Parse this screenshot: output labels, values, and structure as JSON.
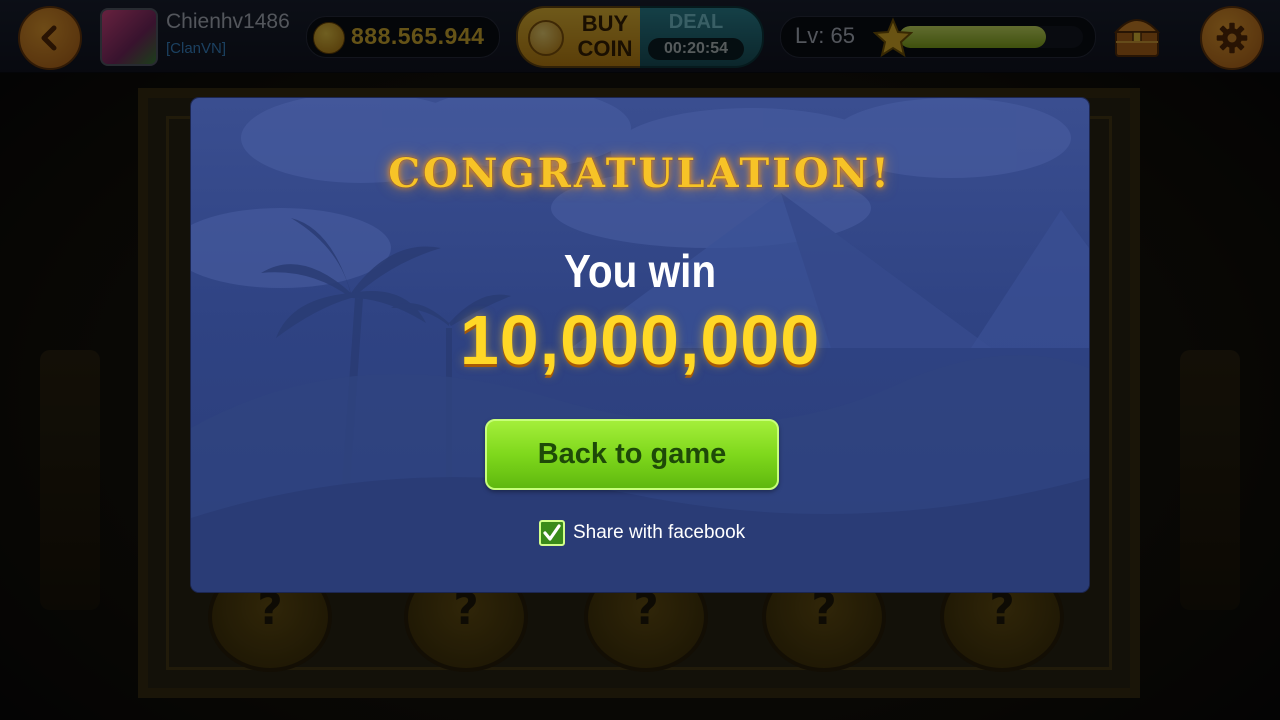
{
  "header": {
    "player_name": "Chienhv1486",
    "clan": "[ClanVN]",
    "coins": "888.565.944",
    "buy_coin_label": "BUY\nCOIN",
    "deal_label": "DEAL",
    "deal_timer": "00:20:54",
    "level_label": "Lv: 65",
    "level_progress": 0.8
  },
  "modal": {
    "title": "CONGRATULATION!",
    "you_win": "You win",
    "amount": "10,000,000",
    "button_label": "Back to game",
    "share_label": "Share with facebook",
    "share_checked": true
  },
  "board": {
    "medallion_glyph": "?"
  },
  "colors": {
    "accent_orange": "#f3a633",
    "gold": "#ffd826",
    "modal_blue": "#2f4383",
    "button_green": "#7fd81c"
  }
}
